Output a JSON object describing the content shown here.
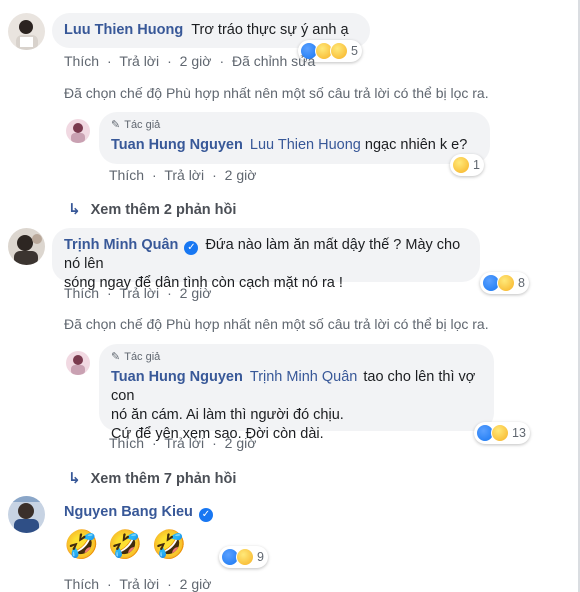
{
  "comments": [
    {
      "name": "Luu Thien Huong",
      "text": "Trơ tráo thực sự ý anh ạ",
      "actions": {
        "like": "Thích",
        "reply": "Trả lời",
        "time": "2 giờ",
        "edited": "Đã chỉnh sửa"
      },
      "reactions": {
        "icons": [
          "like-icon",
          "haha-icon",
          "sad-icon"
        ],
        "count": "5"
      },
      "filter_note": "Đã chọn chế độ Phù hợp nhất nên một số câu trả lời có thể bị lọc ra.",
      "reply": {
        "author_badge": "Tác giả",
        "name": "Tuan Hung Nguyen",
        "mention": "Luu Thien Huong",
        "text": "ngạc nhiên k e?",
        "actions": {
          "like": "Thích",
          "reply": "Trả lời",
          "time": "2 giờ"
        },
        "reactions": {
          "icons": [
            "sad-icon"
          ],
          "count": "1"
        }
      },
      "more_replies": "Xem thêm 2 phản hồi"
    },
    {
      "name": "Trịnh Minh Quân",
      "verified": true,
      "text_line1": "Đứa nào làm ăn mất dậy thế ? Mày cho nó lên",
      "text_line2": "sóng ngay để dân tình còn cạch mặt nó ra !",
      "actions": {
        "like": "Thích",
        "reply": "Trả lời",
        "time": "2 giờ"
      },
      "reactions": {
        "icons": [
          "like-icon",
          "haha-icon"
        ],
        "count": "8"
      },
      "filter_note": "Đã chọn chế độ Phù hợp nhất nên một số câu trả lời có thể bị lọc ra.",
      "reply": {
        "author_badge": "Tác giả",
        "name": "Tuan Hung Nguyen",
        "mention": "Trịnh Minh Quân",
        "text_line1": "tao cho lên thì vợ con",
        "text_line2": "nó ăn cám. Ai làm thì người đó chịu.",
        "text_line3": "Cứ để yên xem sao. Đời còn dài.",
        "actions": {
          "like": "Thích",
          "reply": "Trả lời",
          "time": "2 giờ"
        },
        "reactions": {
          "icons": [
            "like-icon",
            "haha-icon"
          ],
          "count": "13"
        }
      },
      "more_replies": "Xem thêm 7 phản hồi"
    },
    {
      "name": "Nguyen Bang Kieu",
      "verified": true,
      "emojis": [
        "🤣",
        "🤣",
        "🤣"
      ],
      "actions": {
        "like": "Thích",
        "reply": "Trả lời",
        "time": "2 giờ"
      },
      "reactions": {
        "icons": [
          "like-icon",
          "haha-icon"
        ],
        "count": "9"
      }
    }
  ],
  "colors": {
    "link": "#385898",
    "bubble": "#f2f3f5",
    "meta": "#606770",
    "like": "#1877f2",
    "haha": "#f7b125"
  }
}
